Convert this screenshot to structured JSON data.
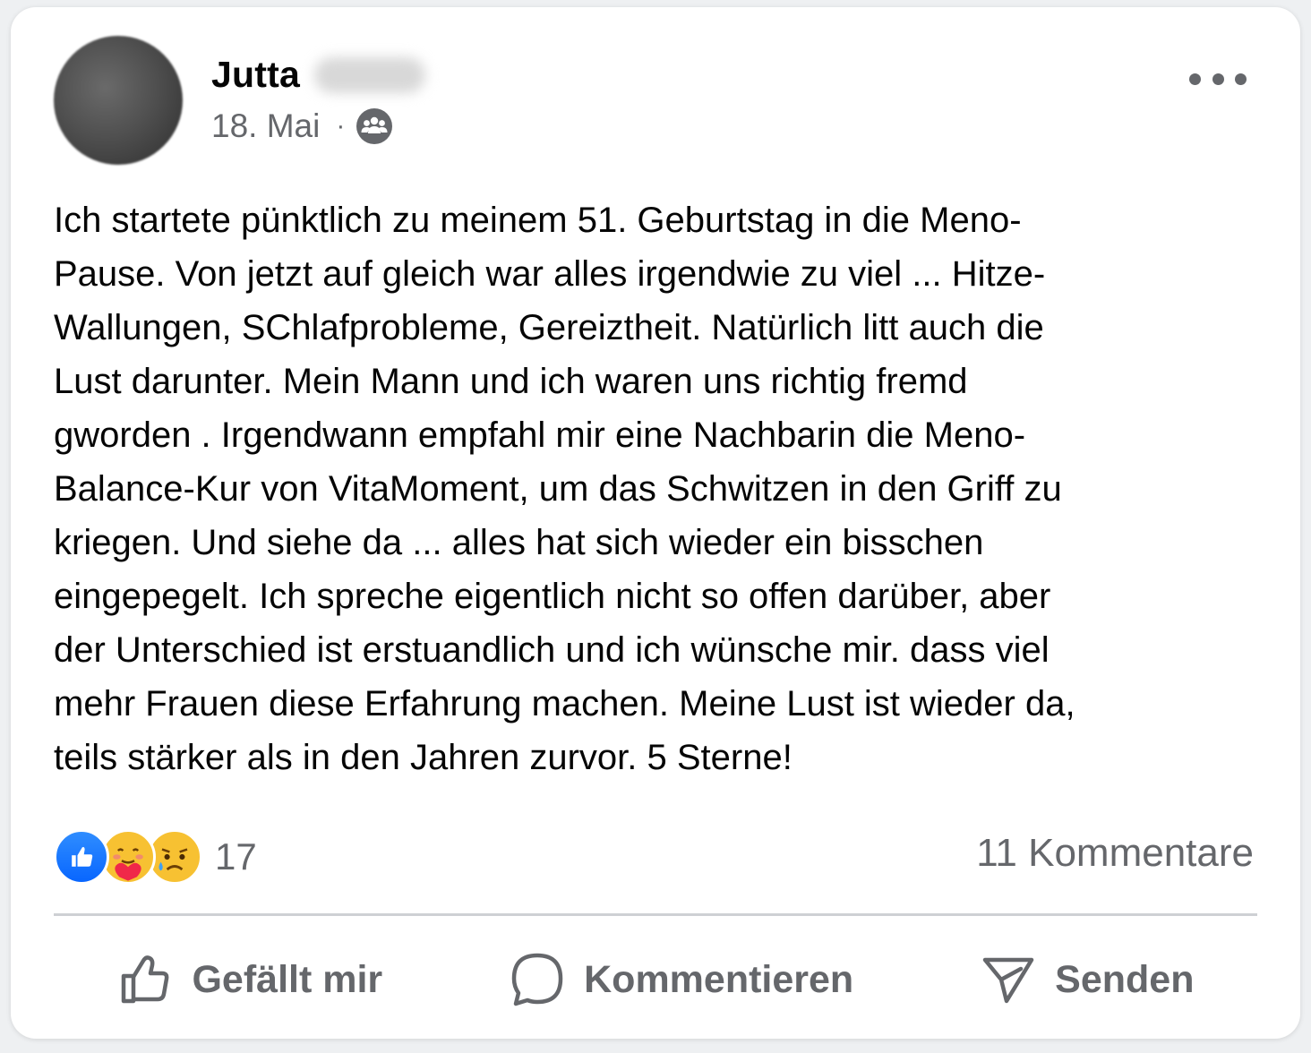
{
  "post": {
    "author_first_name": "Jutta",
    "date": "18. Mai",
    "separator": "·",
    "audience_icon": "group-icon",
    "more_icon": "more-horizontal-icon",
    "text": "Ich startete pünktlich zu meinem 51. Geburtstag in die Meno-\nPause. Von jetzt auf gleich war alles irgendwie zu viel ... Hitze-\nWallungen, SChlafprobleme, Gereiztheit. Natürlich litt auch die\nLust darunter. Mein Mann und ich waren uns richtig fremd\ngworden . Irgendwann empfahl mir eine Nachbarin die Meno-\nBalance-Kur von VitaMoment, um das Schwitzen in den Griff zu\nkriegen. Und siehe da ... alles hat sich wieder ein bisschen\neingepegelt. Ich spreche eigentlich nicht so offen darüber, aber\nder Unterschied ist erstuandlich und ich wünsche mir. dass viel\nmehr Frauen diese Erfahrung machen. Meine Lust ist wieder da,\nteils stärker als in den Jahren zurvor. 5 Sterne!"
  },
  "reactions": {
    "icons": [
      "like-reaction-icon",
      "care-reaction-icon",
      "sad-reaction-icon"
    ],
    "count": "17"
  },
  "comments": {
    "label": "11 Kommentare"
  },
  "actions": {
    "like_label": "Gefällt mir",
    "comment_label": "Kommentieren",
    "send_label": "Senden"
  },
  "colors": {
    "text": "#050505",
    "secondary": "#65676b",
    "like_blue": "#0866ff",
    "divider": "#ced0d4",
    "card": "#ffffff"
  }
}
